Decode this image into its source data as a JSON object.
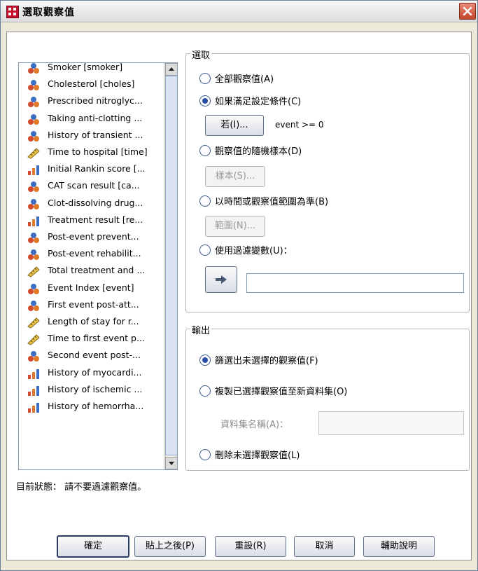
{
  "window": {
    "title": "選取觀察值"
  },
  "variables": [
    {
      "label": "Smoker [smoker]",
      "icon": "nominal-icon"
    },
    {
      "label": "Cholesterol [choles]",
      "icon": "nominal-icon"
    },
    {
      "label": "Prescribed nitroglyc...",
      "icon": "nominal-icon"
    },
    {
      "label": "Taking anti-clotting ...",
      "icon": "nominal-icon"
    },
    {
      "label": "History of transient ...",
      "icon": "nominal-icon"
    },
    {
      "label": "Time to hospital [time]",
      "icon": "scale-icon"
    },
    {
      "label": "Initial Rankin score [...",
      "icon": "ordinal-icon"
    },
    {
      "label": "CAT scan result [ca...",
      "icon": "nominal-icon"
    },
    {
      "label": "Clot-dissolving drug...",
      "icon": "nominal-icon"
    },
    {
      "label": "Treatment result [re...",
      "icon": "ordinal-icon"
    },
    {
      "label": "Post-event prevent...",
      "icon": "nominal-icon"
    },
    {
      "label": "Post-event rehabilit...",
      "icon": "nominal-icon"
    },
    {
      "label": "Total treatment and ...",
      "icon": "scale-icon"
    },
    {
      "label": "Event Index [event]",
      "icon": "nominal-icon"
    },
    {
      "label": "First event post-att...",
      "icon": "nominal-icon"
    },
    {
      "label": "Length of stay for r...",
      "icon": "scale-icon"
    },
    {
      "label": "Time to first event p...",
      "icon": "scale-icon"
    },
    {
      "label": "Second event post-...",
      "icon": "nominal-icon"
    },
    {
      "label": "History of myocardi...",
      "icon": "ordinal-icon"
    },
    {
      "label": "History of ischemic ...",
      "icon": "ordinal-icon"
    },
    {
      "label": "History of hemorrha...",
      "icon": "ordinal-icon"
    }
  ],
  "select_group": {
    "title": "選取",
    "all_cases": "全部觀察值(A)",
    "if_condition": "如果滿足設定條件(C)",
    "if_button": "若(I)...",
    "condition_text": "event >= 0",
    "random_sample": "觀察值的隨機樣本(D)",
    "sample_button": "樣本(S)...",
    "range": "以時間或觀察值範圍為準(B)",
    "range_button": "範圍(N)...",
    "filter_var": "使用過濾變數(U)：",
    "filter_value": "",
    "selected": "if_condition"
  },
  "output_group": {
    "title": "輸出",
    "filter_out": "篩選出未選擇的觀察值(F)",
    "copy_new": "複製已選擇觀察值至新資料集(O)",
    "dataset_name_label": "資料集名稱(A)：",
    "dataset_name_value": "",
    "delete": "刪除未選擇觀察值(L)",
    "selected": "filter_out"
  },
  "status_text": "目前狀態： 請不要過濾觀察值。",
  "buttons": {
    "ok": "確定",
    "paste": "貼上之後(P)",
    "reset": "重設(R)",
    "cancel": "取消",
    "help": "輔助說明"
  }
}
